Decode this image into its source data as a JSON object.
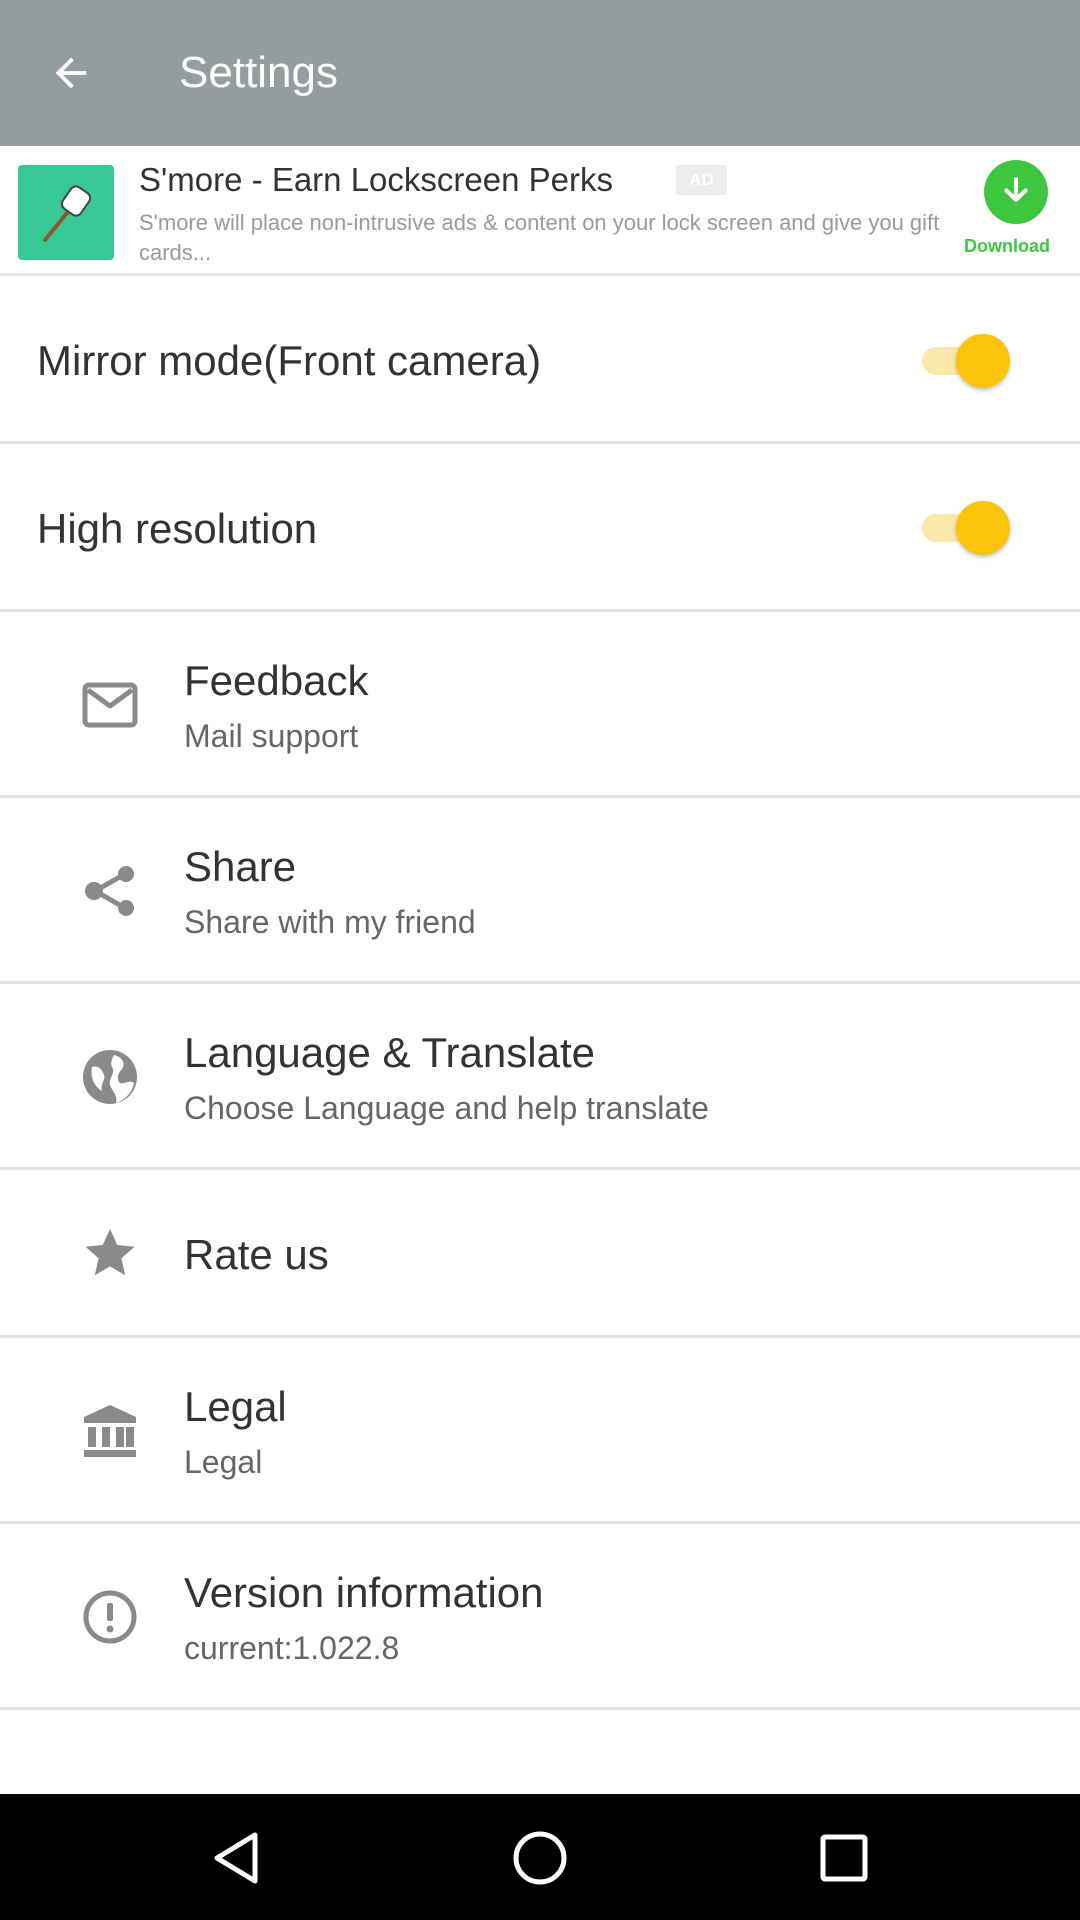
{
  "appbar": {
    "title": "Settings",
    "back_icon": "arrow-left-icon"
  },
  "ad": {
    "title": "S'more - Earn Lockscreen Perks",
    "badge": "AD",
    "description": "S'more will place non-intrusive ads & content on your lock screen and give you gift cards...",
    "download_label": "Download",
    "icon": "marshmallow-icon",
    "colors": {
      "icon_bg": "#37c995",
      "download": "#3ec73e"
    }
  },
  "toggles": [
    {
      "label": "Mirror mode(Front camera)",
      "on": true
    },
    {
      "label": "High resolution",
      "on": true
    }
  ],
  "items": [
    {
      "title": "Feedback",
      "subtitle": "Mail support",
      "icon": "mail-icon"
    },
    {
      "title": "Share",
      "subtitle": "Share with my friend",
      "icon": "share-icon"
    },
    {
      "title": "Language & Translate",
      "subtitle": "Choose Language and help translate",
      "icon": "globe-icon"
    },
    {
      "title": "Rate us",
      "subtitle": "",
      "icon": "star-icon"
    },
    {
      "title": "Legal",
      "subtitle": "Legal",
      "icon": "bank-icon"
    },
    {
      "title": "Version information",
      "subtitle": "current:1.022.8",
      "icon": "info-icon"
    }
  ],
  "navbar": {
    "buttons": [
      "back-triangle-icon",
      "home-circle-icon",
      "recents-square-icon"
    ]
  },
  "colors": {
    "appbar": "#949e9f",
    "switch_on": "#fbc40a",
    "switch_track": "#fbe9ac",
    "icon_gray": "#8a8a8a"
  }
}
